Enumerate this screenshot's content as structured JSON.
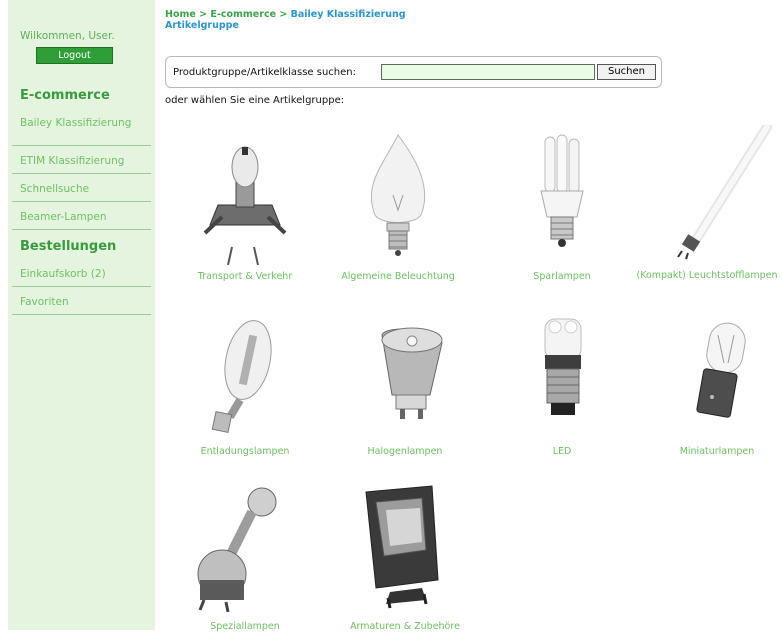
{
  "sidebar": {
    "welcome": "Wilkommen, User.",
    "logout": "Logout",
    "section1": "E-commerce",
    "items1": [
      "Bailey Klassifizierung",
      "ETIM Klassifizierung",
      "Schnellsuche",
      "Beamer-Lampen"
    ],
    "section2": "Bestellungen",
    "items2": [
      "Einkaufskorb (2)",
      "Favoriten"
    ]
  },
  "breadcrumb": {
    "home": "Home",
    "sep": ">",
    "ecommerce": "E-commerce",
    "current": "Bailey Klassifizierung",
    "sub": "Artikelgruppe"
  },
  "search": {
    "label": "Produktgruppe/Artikelklasse suchen:",
    "value": "",
    "button": "Suchen"
  },
  "choose_text": "oder wählen Sie eine Artikelgruppe:",
  "categories": [
    {
      "label": "Transport & Verkehr",
      "icon": "car-lamp-icon"
    },
    {
      "label": "Algemeine Beleuchtung",
      "icon": "candle-bulb-icon"
    },
    {
      "label": "Sparlampen",
      "icon": "energy-saving-lamp-icon"
    },
    {
      "label": "(Kompakt) Leuchtstofflampen",
      "icon": "fluorescent-tube-icon"
    },
    {
      "label": "Entladungslampen",
      "icon": "discharge-lamp-icon"
    },
    {
      "label": "Halogenlampen",
      "icon": "halogen-spot-icon"
    },
    {
      "label": "LED",
      "icon": "led-lamp-icon"
    },
    {
      "label": "Miniaturlampen",
      "icon": "miniature-lamp-icon"
    },
    {
      "label": "Speziallampen",
      "icon": "special-lamp-icon"
    },
    {
      "label": "Armaturen & Zubehöre",
      "icon": "floodlight-fixture-icon"
    }
  ]
}
